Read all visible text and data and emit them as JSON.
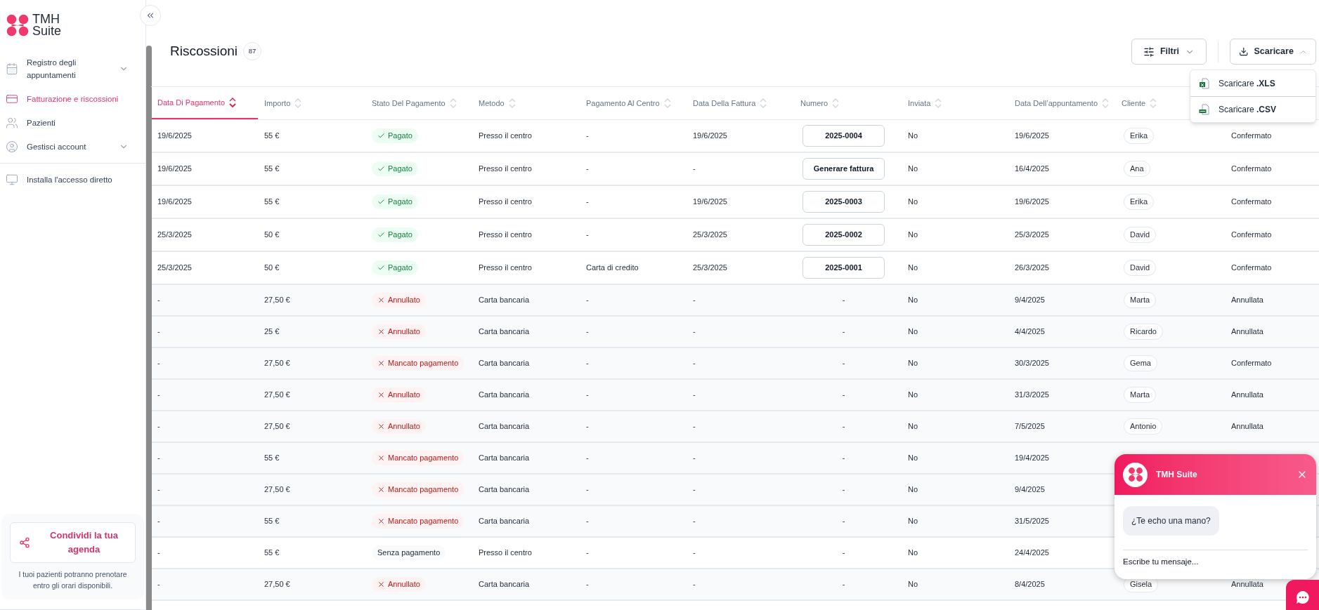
{
  "sidebar": {
    "logo": {
      "line_1": "TMH",
      "line_2": "Suite"
    },
    "items": [
      {
        "label": "Registro degli appuntamenti",
        "selected": false,
        "expanded": false
      },
      {
        "label": "Fatturazione e riscossioni",
        "selected": true
      },
      {
        "label": "Pazienti",
        "selected": false
      },
      {
        "label": "Gestisci account",
        "selected": false,
        "expanded": false
      },
      {
        "label": "Installa l'accesso diretto",
        "selected": false
      }
    ],
    "share_card": {
      "button": "Condividi la tua agenda",
      "description": "I tuoi pazienti potranno prenotare entro gli orari disponibili."
    }
  },
  "page": {
    "title": "Riscossioni",
    "count": "87"
  },
  "toolbar": {
    "filters": {
      "label": "Filtri",
      "expanded": false
    },
    "download": {
      "label": "Scaricare",
      "expanded": true,
      "options": [
        {
          "label": "Scaricare **.XLS**",
          "kind": "xls"
        },
        {
          "label": "Scaricare **.CSV**",
          "kind": "csv"
        }
      ]
    }
  },
  "table": {
    "columns": [
      {
        "label": "Data Di Pagamento",
        "sorted": true
      },
      {
        "label": "Importo",
        "sorted": false
      },
      {
        "label": "Stato Del Pagamento",
        "sorted": false
      },
      {
        "label": "Metodo",
        "sorted": false
      },
      {
        "label": "Pagamento Al Centro",
        "sorted": false
      },
      {
        "label": "Data Della Fattura",
        "sorted": false
      },
      {
        "label": "Numero",
        "sorted": false
      },
      {
        "label": "Inviata",
        "sorted": false
      },
      {
        "label": "Data Dell’appuntamento",
        "sorted": false
      },
      {
        "label": "Cliente",
        "sorted": false
      }
    ],
    "rows": [
      {
        "payment_date": "19/6/2025",
        "amount": "55 €",
        "status": {
          "kind": "paid",
          "label": "Pagato"
        },
        "method": "Presso il centro",
        "paid_at_center": "-",
        "invoice_date": "19/6/2025",
        "number": {
          "kind": "invoice",
          "label": "2025-0004"
        },
        "sent": "No",
        "appointment_date": "19/6/2025",
        "client": "Erika",
        "column_11": "Confermato"
      },
      {
        "payment_date": "19/6/2025",
        "amount": "55 €",
        "status": {
          "kind": "paid",
          "label": "Pagato"
        },
        "method": "Presso il centro",
        "paid_at_center": "-",
        "invoice_date": "-",
        "number": {
          "kind": "action",
          "label": "Generare fattura"
        },
        "sent": "No",
        "appointment_date": "16/4/2025",
        "client": "Ana",
        "column_11": "Confermato"
      },
      {
        "payment_date": "19/6/2025",
        "amount": "55 €",
        "status": {
          "kind": "paid",
          "label": "Pagato"
        },
        "method": "Presso il centro",
        "paid_at_center": "-",
        "invoice_date": "19/6/2025",
        "number": {
          "kind": "invoice",
          "label": "2025-0003"
        },
        "sent": "No",
        "appointment_date": "19/6/2025",
        "client": "Erika",
        "column_11": "Confermato"
      },
      {
        "payment_date": "25/3/2025",
        "amount": "50 €",
        "status": {
          "kind": "paid",
          "label": "Pagato"
        },
        "method": "Presso il centro",
        "paid_at_center": "-",
        "invoice_date": "25/3/2025",
        "number": {
          "kind": "invoice",
          "label": "2025-0002"
        },
        "sent": "No",
        "appointment_date": "25/3/2025",
        "client": "David",
        "column_11": "Confermato"
      },
      {
        "payment_date": "25/3/2025",
        "amount": "50 €",
        "status": {
          "kind": "paid",
          "label": "Pagato"
        },
        "method": "Presso il centro",
        "paid_at_center": "Carta di credito",
        "invoice_date": "25/3/2025",
        "number": {
          "kind": "invoice",
          "label": "2025-0001"
        },
        "sent": "No",
        "appointment_date": "26/3/2025",
        "client": "David",
        "column_11": "Confermato"
      },
      {
        "payment_date": "-",
        "amount": "27,50 €",
        "status": {
          "kind": "error",
          "label": "Annullato"
        },
        "method": "Carta bancaria",
        "paid_at_center": "-",
        "invoice_date": "-",
        "number": {
          "kind": "none",
          "label": "-"
        },
        "sent": "No",
        "appointment_date": "9/4/2025",
        "client": "Marta",
        "column_11": "Annullata"
      },
      {
        "payment_date": "-",
        "amount": "25 €",
        "status": {
          "kind": "error",
          "label": "Annullato"
        },
        "method": "Carta bancaria",
        "paid_at_center": "-",
        "invoice_date": "-",
        "number": {
          "kind": "none",
          "label": "-"
        },
        "sent": "No",
        "appointment_date": "4/4/2025",
        "client": "Ricardo",
        "column_11": "Annullata"
      },
      {
        "payment_date": "-",
        "amount": "27,50 €",
        "status": {
          "kind": "error",
          "label": "Mancato pagamento"
        },
        "method": "Carta bancaria",
        "paid_at_center": "-",
        "invoice_date": "-",
        "number": {
          "kind": "none",
          "label": "-"
        },
        "sent": "No",
        "appointment_date": "30/3/2025",
        "client": "Gema",
        "column_11": "Confermato"
      },
      {
        "payment_date": "-",
        "amount": "27,50 €",
        "status": {
          "kind": "error",
          "label": "Annullato"
        },
        "method": "Carta bancaria",
        "paid_at_center": "-",
        "invoice_date": "-",
        "number": {
          "kind": "none",
          "label": "-"
        },
        "sent": "No",
        "appointment_date": "31/3/2025",
        "client": "Marta",
        "column_11": "Annullata"
      },
      {
        "payment_date": "-",
        "amount": "27,50 €",
        "status": {
          "kind": "error",
          "label": "Annullato"
        },
        "method": "Carta bancaria",
        "paid_at_center": "-",
        "invoice_date": "-",
        "number": {
          "kind": "none",
          "label": "-"
        },
        "sent": "No",
        "appointment_date": "7/5/2025",
        "client": "Antonio",
        "column_11": "Annullata"
      },
      {
        "payment_date": "-",
        "amount": "55 €",
        "status": {
          "kind": "error",
          "label": "Mancato pagamento"
        },
        "method": "Carta bancaria",
        "paid_at_center": "-",
        "invoice_date": "-",
        "number": {
          "kind": "none",
          "label": "-"
        },
        "sent": "No",
        "appointment_date": "19/4/2025"
      },
      {
        "payment_date": "-",
        "amount": "27,50 €",
        "status": {
          "kind": "error",
          "label": "Mancato pagamento"
        },
        "method": "Carta bancaria",
        "paid_at_center": "-",
        "invoice_date": "-",
        "number": {
          "kind": "none",
          "label": "-"
        },
        "sent": "No",
        "appointment_date": "9/4/2025"
      },
      {
        "payment_date": "-",
        "amount": "55 €",
        "status": {
          "kind": "error",
          "label": "Mancato pagamento"
        },
        "method": "Carta bancaria",
        "paid_at_center": "-",
        "invoice_date": "-",
        "number": {
          "kind": "none",
          "label": "-"
        },
        "sent": "No",
        "appointment_date": "31/5/2025"
      },
      {
        "payment_date": "-",
        "amount": "55 €",
        "status": {
          "kind": "neutral",
          "label": "Senza pagamento"
        },
        "method": "Presso il centro",
        "paid_at_center": "-",
        "invoice_date": "-",
        "number": {
          "kind": "none",
          "label": "-"
        },
        "sent": "No",
        "appointment_date": "24/4/2025"
      },
      {
        "payment_date": "-",
        "amount": "27,50 €",
        "status": {
          "kind": "error",
          "label": "Annullato"
        },
        "method": "Carta bancaria",
        "paid_at_center": "-",
        "invoice_date": "-",
        "number": {
          "kind": "none",
          "label": "-"
        },
        "sent": "No",
        "appointment_date": "8/4/2025",
        "client": "Gisela",
        "column_11": "Annullata"
      }
    ]
  },
  "chat": {
    "title": "TMH Suite",
    "message": "¿Te echo una mano?",
    "placeholder": "Escribe tu mensaje..."
  }
}
